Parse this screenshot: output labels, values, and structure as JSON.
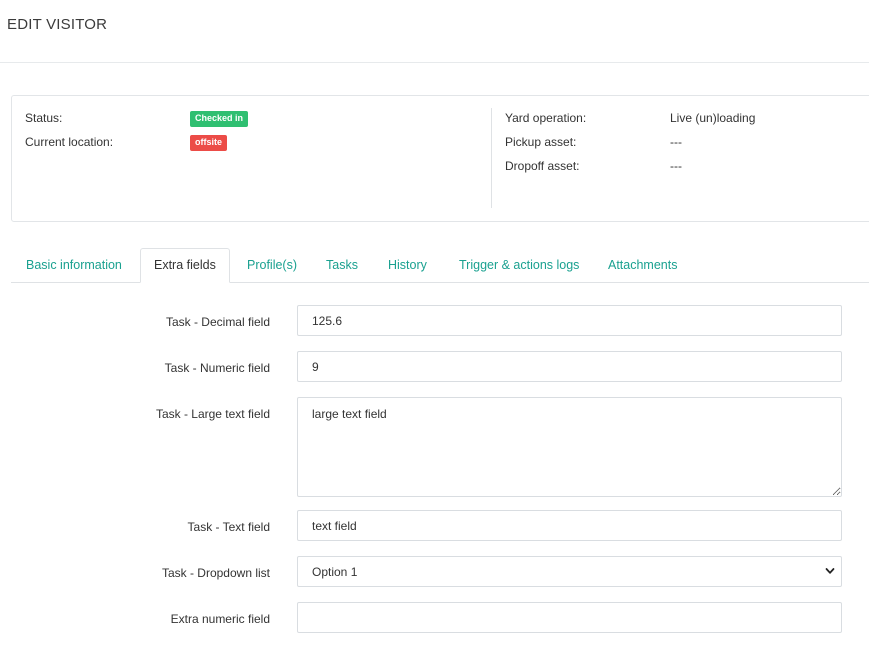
{
  "header": {
    "title": "EDIT VISITOR"
  },
  "summary": {
    "left": {
      "status_label": "Status:",
      "status_badge": "Checked in",
      "location_label": "Current location:",
      "location_badge": "offsite"
    },
    "right": {
      "yard_label": "Yard operation:",
      "yard_value": "Live (un)loading",
      "pickup_label": "Pickup asset:",
      "pickup_value": "---",
      "dropoff_label": "Dropoff asset:",
      "dropoff_value": "---"
    },
    "colors": {
      "checked_in": "#2fbf71",
      "offsite": "#ec4c47"
    }
  },
  "tabs": [
    {
      "label": "Basic information"
    },
    {
      "label": "Extra fields",
      "active": true
    },
    {
      "label": "Profile(s)"
    },
    {
      "label": "Tasks"
    },
    {
      "label": "History"
    },
    {
      "label": "Trigger & actions logs"
    },
    {
      "label": "Attachments"
    }
  ],
  "form": {
    "decimal": {
      "label": "Task - Decimal field",
      "value": "125.6"
    },
    "numeric": {
      "label": "Task - Numeric field",
      "value": "9"
    },
    "large_text": {
      "label": "Task - Large text field",
      "value": "large text field"
    },
    "text": {
      "label": "Task - Text field",
      "value": "text field"
    },
    "dropdown": {
      "label": "Task - Dropdown list",
      "value": "Option 1"
    },
    "extra_numeric": {
      "label": "Extra numeric field",
      "value": ""
    }
  },
  "colors": {
    "accent": "#1aa190"
  }
}
